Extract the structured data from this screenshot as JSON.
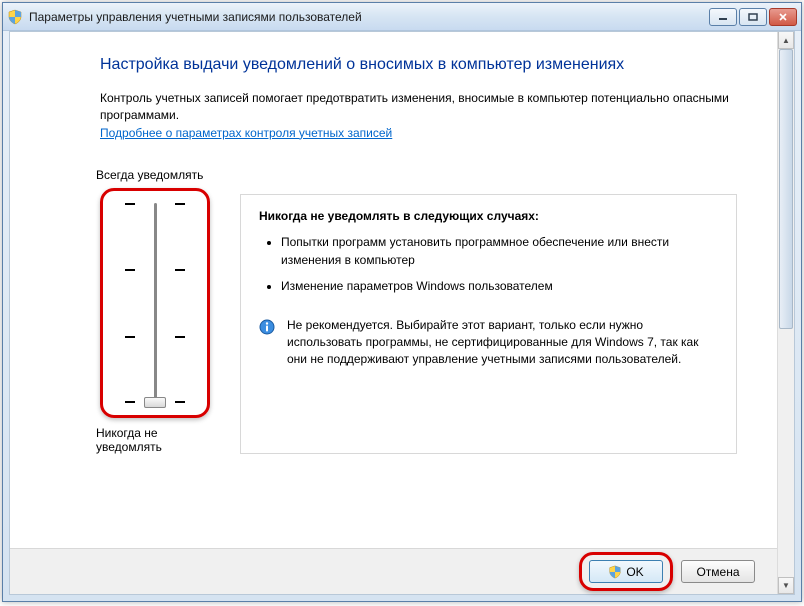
{
  "window": {
    "title": "Параметры управления учетными записями пользователей"
  },
  "page": {
    "heading": "Настройка выдачи уведомлений о вносимых в компьютер изменениях",
    "intro": "Контроль учетных записей помогает предотвратить изменения, вносимые в компьютер потенциально опасными программами.",
    "help_link": "Подробнее о параметрах контроля учетных записей"
  },
  "slider": {
    "top_label": "Всегда уведомлять",
    "bottom_label": "Никогда не уведомлять",
    "levels": 4,
    "current_level": 0
  },
  "description": {
    "title": "Никогда не уведомлять в следующих случаях:",
    "bullets": [
      "Попытки программ установить программное обеспечение или внести изменения в компьютер",
      "Изменение параметров Windows пользователем"
    ],
    "info_text": "Не рекомендуется. Выбирайте этот вариант, только если нужно использовать программы, не сертифицированные для Windows 7, так как они не поддерживают управление учетными записями пользователей."
  },
  "buttons": {
    "ok": "OK",
    "cancel": "Отмена"
  }
}
